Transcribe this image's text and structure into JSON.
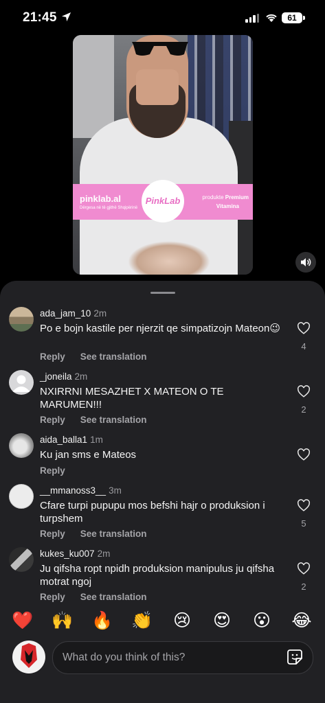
{
  "status_bar": {
    "time": "21:45",
    "battery": "61"
  },
  "video": {
    "banner_brand": "pinklab.al",
    "banner_tagline": "Dërgesa në të gjithë Shqipërinë",
    "banner_logo": "PinkLab",
    "promo_prefix": "produkte ",
    "promo_bold": "Premium",
    "promo_line2": "Vitamina"
  },
  "comments": [
    {
      "user": "ada_jam_10",
      "age": "2m",
      "text": "Po e bojn kastile per njerzit qe simpatizojn Mateon😉",
      "reply": "Reply",
      "see_translation": "See translation",
      "likes": "4"
    },
    {
      "user": "_joneila",
      "age": "2m",
      "text": "NXIRRNI MESAZHET X MATEON O TE MARUMEN!!!",
      "reply": "Reply",
      "see_translation": "See translation",
      "likes": "2"
    },
    {
      "user": "aida_balla1",
      "age": "1m",
      "text": "Ku jan sms e Mateos",
      "reply": "Reply",
      "see_translation": "",
      "likes": ""
    },
    {
      "user": "__mmanoss3__",
      "age": "3m",
      "text": "Cfare turpi pupupu mos befshi hajr o produksion i turpshem",
      "reply": "Reply",
      "see_translation": "See translation",
      "likes": "5"
    },
    {
      "user": "kukes_ku007",
      "age": "2m",
      "text": "Ju qifsha ropt npidh produksion manipulus ju qifsha motrat ngoj",
      "reply": "Reply",
      "see_translation": "See translation",
      "likes": "2"
    }
  ],
  "reactions": [
    "❤️",
    "🙌",
    "🔥",
    "👏",
    "😢",
    "😍",
    "😮",
    "😂"
  ],
  "composer": {
    "placeholder": "What do you think of this?",
    "avatar_text": "SHQIPERIA"
  },
  "icons": [
    "location-arrow-icon",
    "signal-icon",
    "wifi-icon",
    "battery-icon",
    "speaker-icon",
    "heart-icon",
    "sticker-icon"
  ]
}
